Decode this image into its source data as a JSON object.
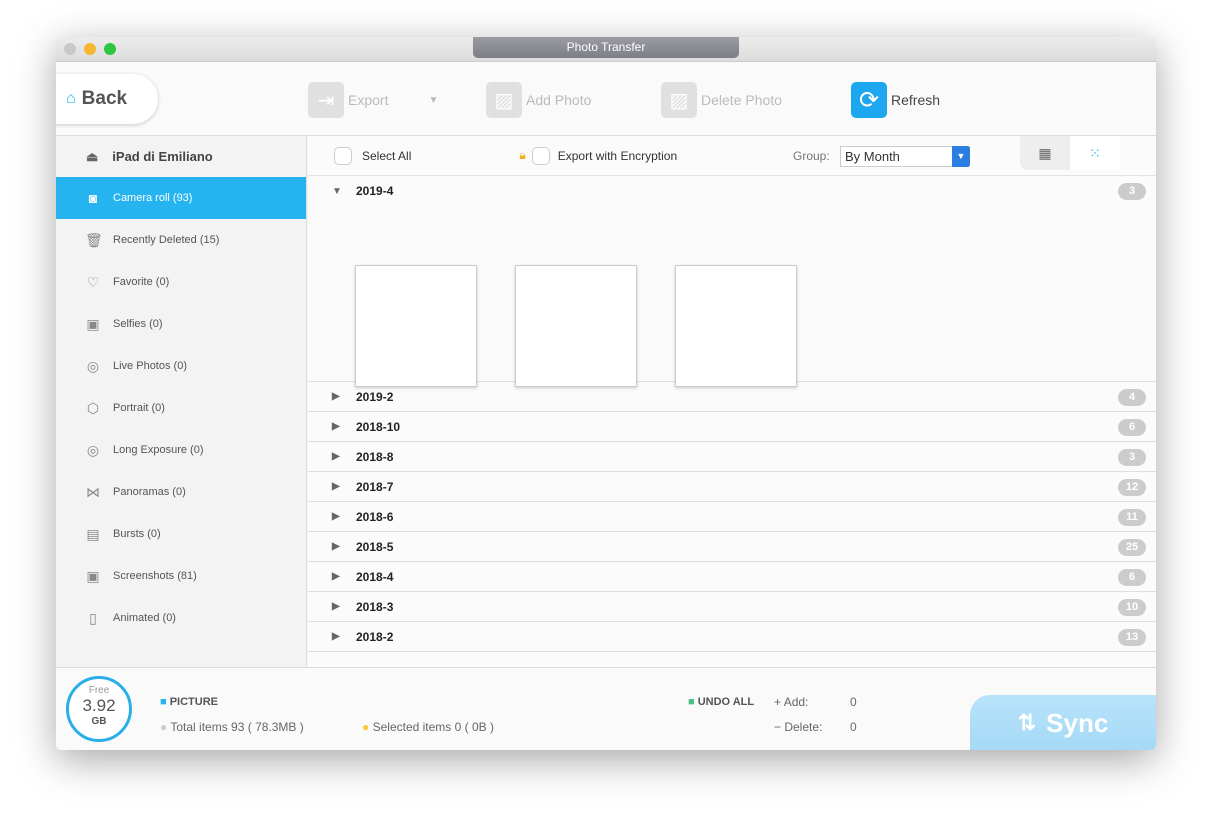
{
  "window": {
    "title": "Photo Transfer"
  },
  "toolbar": {
    "back": "Back",
    "export": "Export",
    "add_photo": "Add Photo",
    "delete_photo": "Delete Photo",
    "refresh": "Refresh"
  },
  "sidebar": {
    "device": "iPad di Emiliano",
    "items": [
      {
        "label": "Camera roll (93)",
        "icon": "camera-icon",
        "glyph": "◙"
      },
      {
        "label": "Recently Deleted (15)",
        "icon": "trash-icon",
        "glyph": "🗑"
      },
      {
        "label": "Favorite (0)",
        "icon": "heart-icon",
        "glyph": "♡"
      },
      {
        "label": "Selfies (0)",
        "icon": "selfie-icon",
        "glyph": "▣"
      },
      {
        "label": "Live Photos (0)",
        "icon": "live-photo-icon",
        "glyph": "◎"
      },
      {
        "label": "Portrait (0)",
        "icon": "cube-icon",
        "glyph": "⬡"
      },
      {
        "label": "Long Exposure (0)",
        "icon": "long-exposure-icon",
        "glyph": "◎"
      },
      {
        "label": "Panoramas (0)",
        "icon": "panorama-icon",
        "glyph": "⋈"
      },
      {
        "label": "Bursts (0)",
        "icon": "bursts-icon",
        "glyph": "▤"
      },
      {
        "label": "Screenshots (81)",
        "icon": "screenshot-icon",
        "glyph": "▣"
      },
      {
        "label": "Animated (0)",
        "icon": "animated-icon",
        "glyph": "▯"
      }
    ]
  },
  "main": {
    "select_all": "Select All",
    "export_encryption": "Export with Encryption",
    "group_label": "Group:",
    "group_value": "By Month",
    "expanded": {
      "name": "2019-4",
      "count": "3"
    },
    "groups": [
      {
        "name": "2019-2",
        "count": "4"
      },
      {
        "name": "2018-10",
        "count": "6"
      },
      {
        "name": "2018-8",
        "count": "3"
      },
      {
        "name": "2018-7",
        "count": "12"
      },
      {
        "name": "2018-6",
        "count": "11"
      },
      {
        "name": "2018-5",
        "count": "25"
      },
      {
        "name": "2018-4",
        "count": "6"
      },
      {
        "name": "2018-3",
        "count": "10"
      },
      {
        "name": "2018-2",
        "count": "13"
      }
    ]
  },
  "footer": {
    "free_label": "Free",
    "free_value": "3.92",
    "free_unit": "GB",
    "picture": "PICTURE",
    "total": "Total items 93 ( 78.3MB )",
    "selected": "Selected items 0 ( 0B )",
    "undo_all": "UNDO ALL",
    "add_label": "Add:",
    "add_value": "0",
    "delete_label": "Delete:",
    "delete_value": "0",
    "sync": "Sync"
  },
  "colors": {
    "accent": "#25b4ef",
    "sync": "#b8e3fa"
  }
}
